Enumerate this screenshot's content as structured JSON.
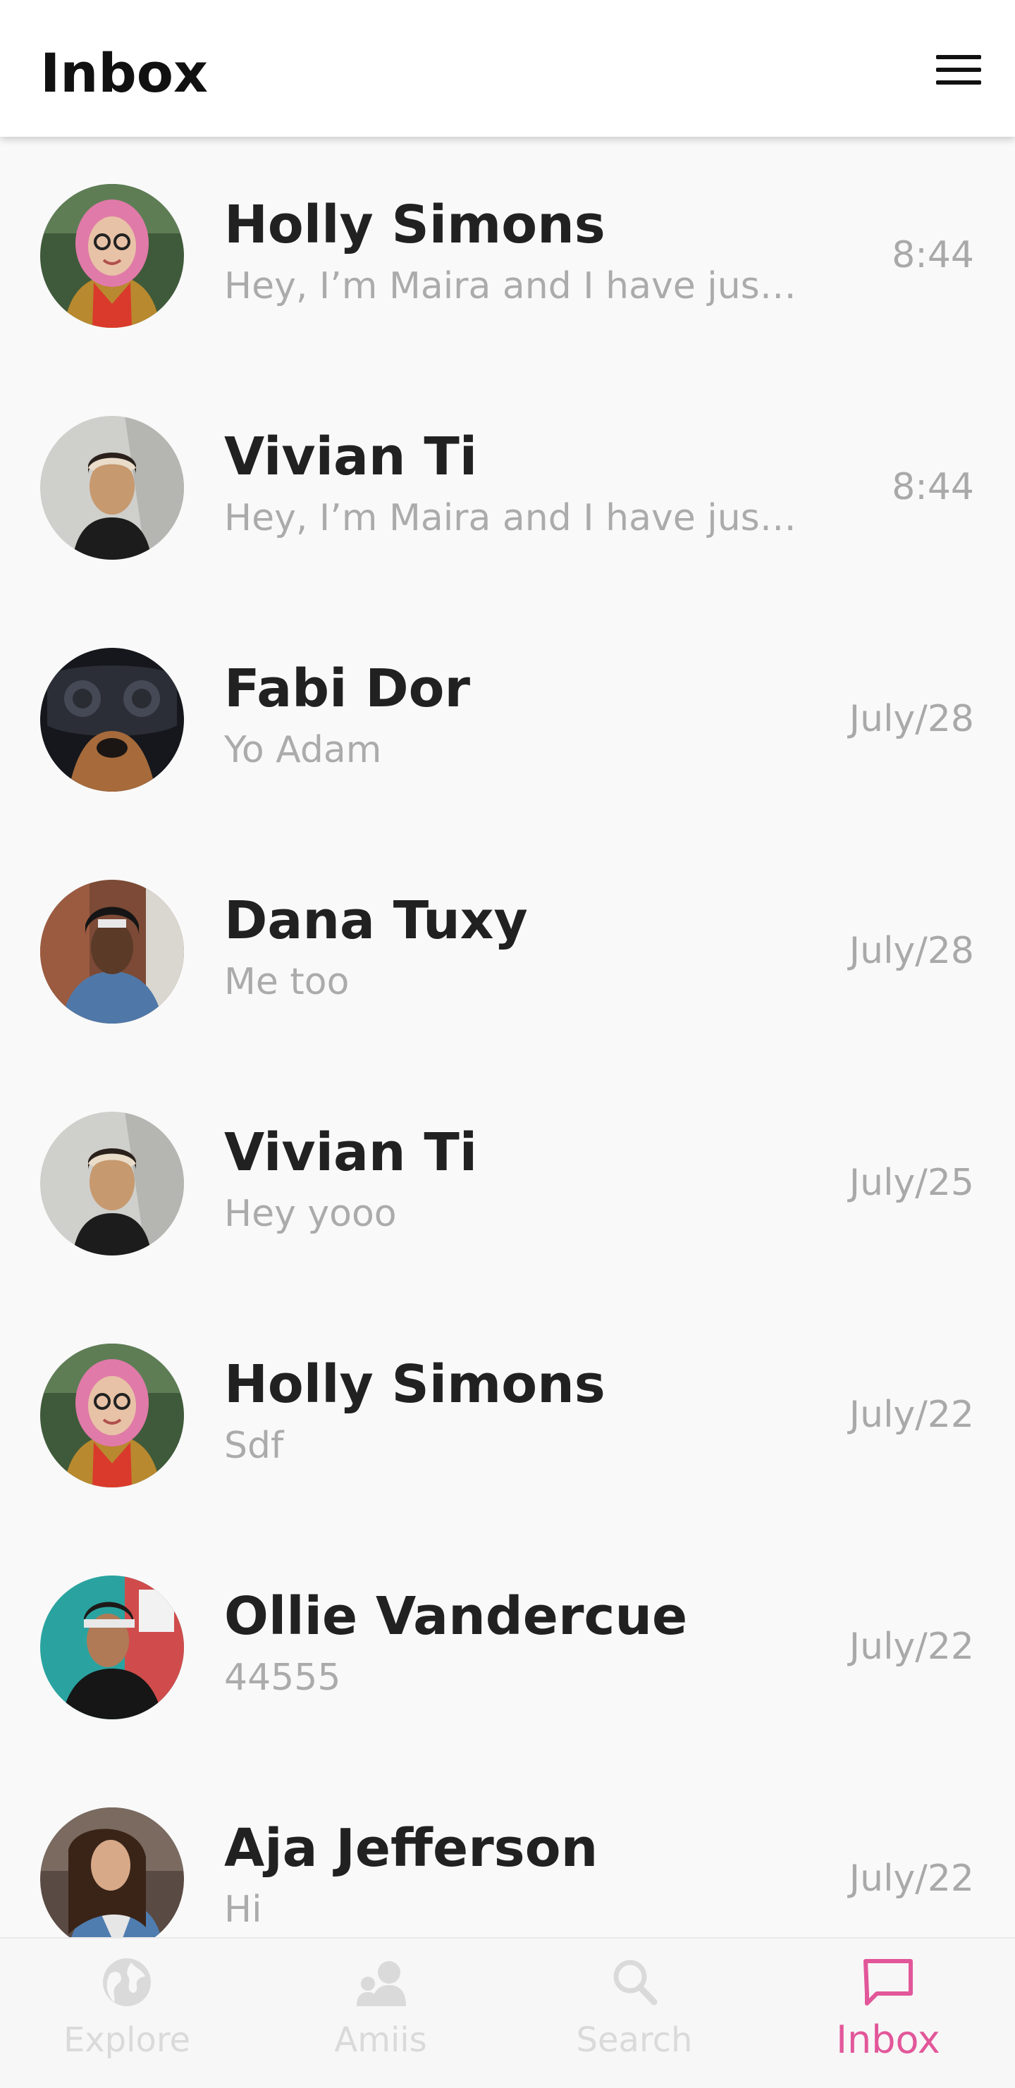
{
  "header": {
    "title": "Inbox",
    "menu_icon": "hamburger-menu-icon"
  },
  "conversations": [
    {
      "name": "Holly Simons",
      "preview": "Hey, I’m Maira and I have just ...",
      "time": "8:44",
      "avatar": "photo-avatar-holly-simons"
    },
    {
      "name": "Vivian Ti",
      "preview": "Hey, I’m Maira and I have just ...",
      "time": "8:44",
      "avatar": "photo-avatar-vivian-ti"
    },
    {
      "name": "Fabi Dor",
      "preview": "Yo Adam",
      "time": "July/28",
      "avatar": "photo-avatar-fabi-dor"
    },
    {
      "name": "Dana Tuxy",
      "preview": "Me too",
      "time": "July/28",
      "avatar": "photo-avatar-dana-tuxy"
    },
    {
      "name": "Vivian Ti",
      "preview": "Hey yooo",
      "time": "July/25",
      "avatar": "photo-avatar-vivian-ti"
    },
    {
      "name": "Holly Simons",
      "preview": "Sdf",
      "time": "July/22",
      "avatar": "photo-avatar-holly-simons"
    },
    {
      "name": "Ollie Vandercue",
      "preview": "44555",
      "time": "July/22",
      "avatar": "photo-avatar-ollie-vandercue"
    },
    {
      "name": "Aja Jefferson",
      "preview": "Hi",
      "time": "July/22",
      "avatar": "photo-avatar-aja-jefferson"
    }
  ],
  "bottom_nav": {
    "items": [
      {
        "label": "Explore",
        "icon": "globe-icon",
        "active": false
      },
      {
        "label": "Amiis",
        "icon": "people-icon",
        "active": false
      },
      {
        "label": "Search",
        "icon": "search-icon",
        "active": false
      },
      {
        "label": "Inbox",
        "icon": "chat-bubble-icon",
        "active": true
      }
    ]
  },
  "colors": {
    "accent": "#e2579a",
    "inactive_nav": "#dadada",
    "header_bg": "#ffffff",
    "page_bg": "#f9f9f9",
    "name_text": "#212121",
    "secondary_text": "#ababab"
  }
}
